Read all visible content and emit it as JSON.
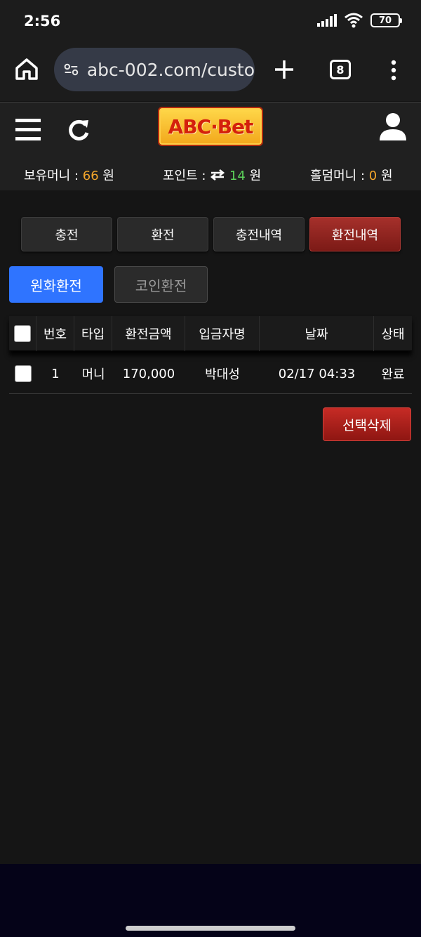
{
  "status_bar": {
    "time": "2:56",
    "battery": "70"
  },
  "browser": {
    "url": "abc-002.com/custo",
    "tab_count": "8"
  },
  "header": {
    "logo_text": "ABC·Bet",
    "money": {
      "label": "보유머니 :",
      "value": "66",
      "unit": "원"
    },
    "points": {
      "label": "포인트 :",
      "value": "14",
      "unit": "원"
    },
    "holdem": {
      "label": "홀덤머니 :",
      "value": "0",
      "unit": "원"
    }
  },
  "tabs": [
    {
      "label": "충전"
    },
    {
      "label": "환전"
    },
    {
      "label": "충전내역"
    },
    {
      "label": "환전내역",
      "active": true
    }
  ],
  "sub_tabs": {
    "won": "원화환전",
    "coin": "코인환전"
  },
  "table": {
    "headers": {
      "no": "번호",
      "type": "타입",
      "amount": "환전금액",
      "depositor": "입금자명",
      "date": "날짜",
      "status": "상태"
    },
    "rows": [
      {
        "no": "1",
        "type": "머니",
        "amount": "170,000",
        "depositor": "박대성",
        "date": "02/17 04:33",
        "status": "완료"
      }
    ]
  },
  "delete_button": "선택삭제",
  "colors": {
    "accent_red": "#a5302b",
    "primary_blue": "#2f74ff",
    "money_orange": "#f2a52b",
    "points_green": "#5dd35b"
  }
}
